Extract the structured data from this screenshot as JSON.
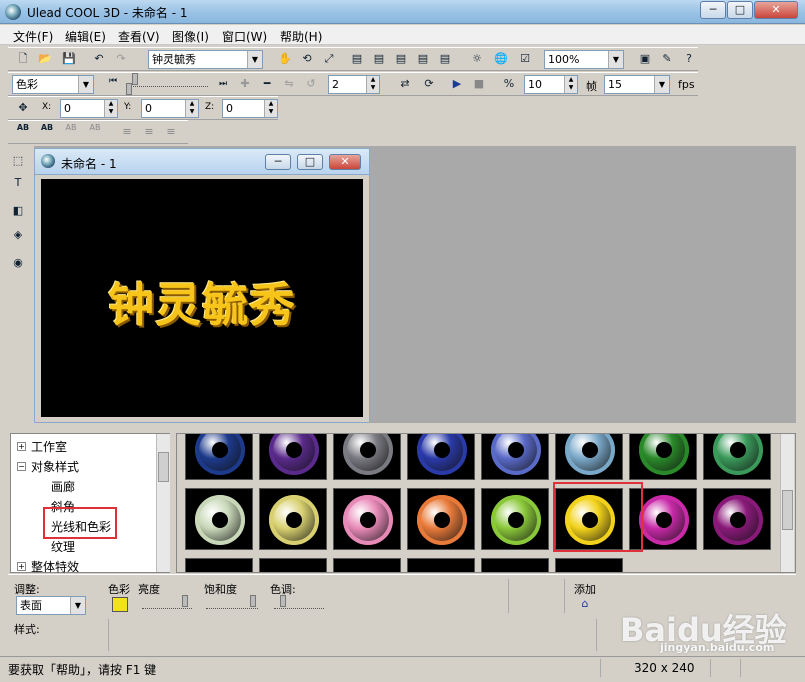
{
  "window": {
    "title": "Ulead COOL 3D - 未命名 - 1",
    "min": "─",
    "max": "□",
    "close": "✕"
  },
  "menu": [
    "文件(F)",
    "编辑(E)",
    "查看(V)",
    "图像(I)",
    "窗口(W)",
    "帮助(H)"
  ],
  "toolbar1": {
    "text_combo": "钟灵毓秀",
    "zoom_combo": "100%"
  },
  "toolbar2": {
    "object_combo": "色彩",
    "frame_value": "2",
    "frames_value": "10",
    "frame_label": "帧",
    "fps_value": "15",
    "fps_label": "fps"
  },
  "toolbar3": {
    "x_label": "X:",
    "x_value": "0",
    "y_label": "Y:",
    "y_value": "0",
    "z_label": "Z:",
    "z_value": "0"
  },
  "toolbar4": {
    "ab1": "AB",
    "ab2": "AB",
    "ab3": "AB",
    "ab4": "AB"
  },
  "document": {
    "title": "未命名 - 1",
    "canvas_text": "钟灵毓秀"
  },
  "tree": {
    "items": [
      "工作室",
      "对象样式",
      "画廊",
      "斜角",
      "光线和色彩",
      "纹理",
      "整体特效"
    ],
    "expanders": [
      "+",
      "−",
      "+"
    ]
  },
  "gallery": {
    "row1": [
      "#1d3a8c",
      "#5a2a8c",
      "#7a7a82",
      "#2a3aa8",
      "#5a6ac8",
      "#7aa8c8",
      "#2a8a2a",
      "#3a9a5a"
    ],
    "row2": [
      "#c8d8b8",
      "#d8d070",
      "#e88ab8",
      "#e87a3a",
      "#8ac83a",
      "#f2d21a",
      "#c82aa8",
      "#8a1a7a"
    ],
    "selected_index": 5
  },
  "bottom": {
    "adjust_label": "调整:",
    "adjust_value": "表面",
    "color_label": "色彩",
    "brightness_label": "亮度",
    "saturation_label": "饱和度",
    "hue_label": "色调:",
    "add_label": "添加",
    "style_label": "样式:",
    "color_swatch": "#f2e21a"
  },
  "status": {
    "help": "要获取「帮助」，请按 F1 键",
    "size": "320 x 240"
  },
  "watermark": {
    "brand": "Baidu经验",
    "url": "jingyan.baidu.com"
  }
}
